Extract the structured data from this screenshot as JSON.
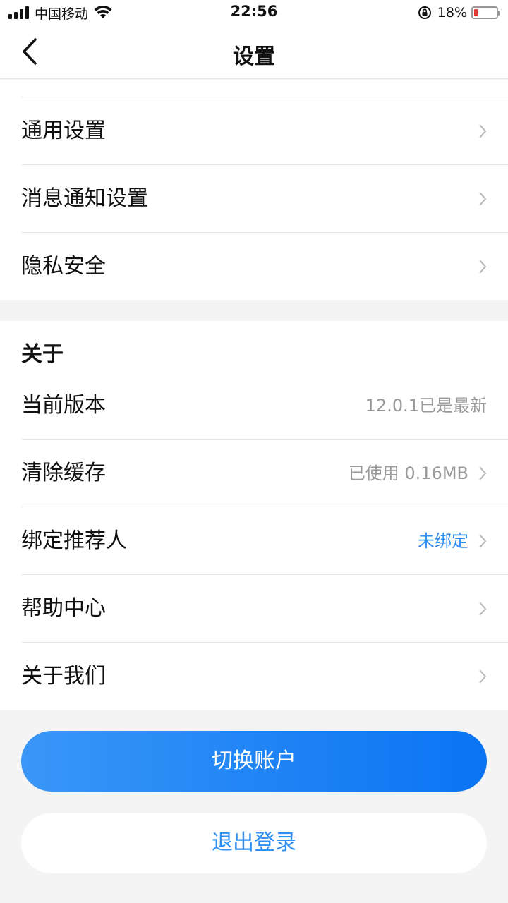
{
  "status_bar": {
    "carrier": "中国移动",
    "time": "22:56",
    "battery_percent": "18%"
  },
  "nav": {
    "title": "设置",
    "back_icon": "chevron-left-icon"
  },
  "general_group": {
    "items": [
      {
        "label": "通用设置",
        "value": ""
      },
      {
        "label": "消息通知设置",
        "value": ""
      },
      {
        "label": "隐私安全",
        "value": ""
      }
    ]
  },
  "about_group": {
    "title": "关于",
    "items": [
      {
        "label": "当前版本",
        "value": "12.0.1已是最新"
      },
      {
        "label": "清除缓存",
        "value": "已使用 0.16MB"
      },
      {
        "label": "绑定推荐人",
        "value": "未绑定"
      },
      {
        "label": "帮助中心",
        "value": ""
      },
      {
        "label": "关于我们",
        "value": ""
      }
    ]
  },
  "buttons": {
    "switch_account": "切换账户",
    "logout": "退出登录"
  },
  "colors": {
    "accent_blue": "#2f8ff3",
    "battery_low": "#e53935",
    "background": "#f4f4f4"
  }
}
